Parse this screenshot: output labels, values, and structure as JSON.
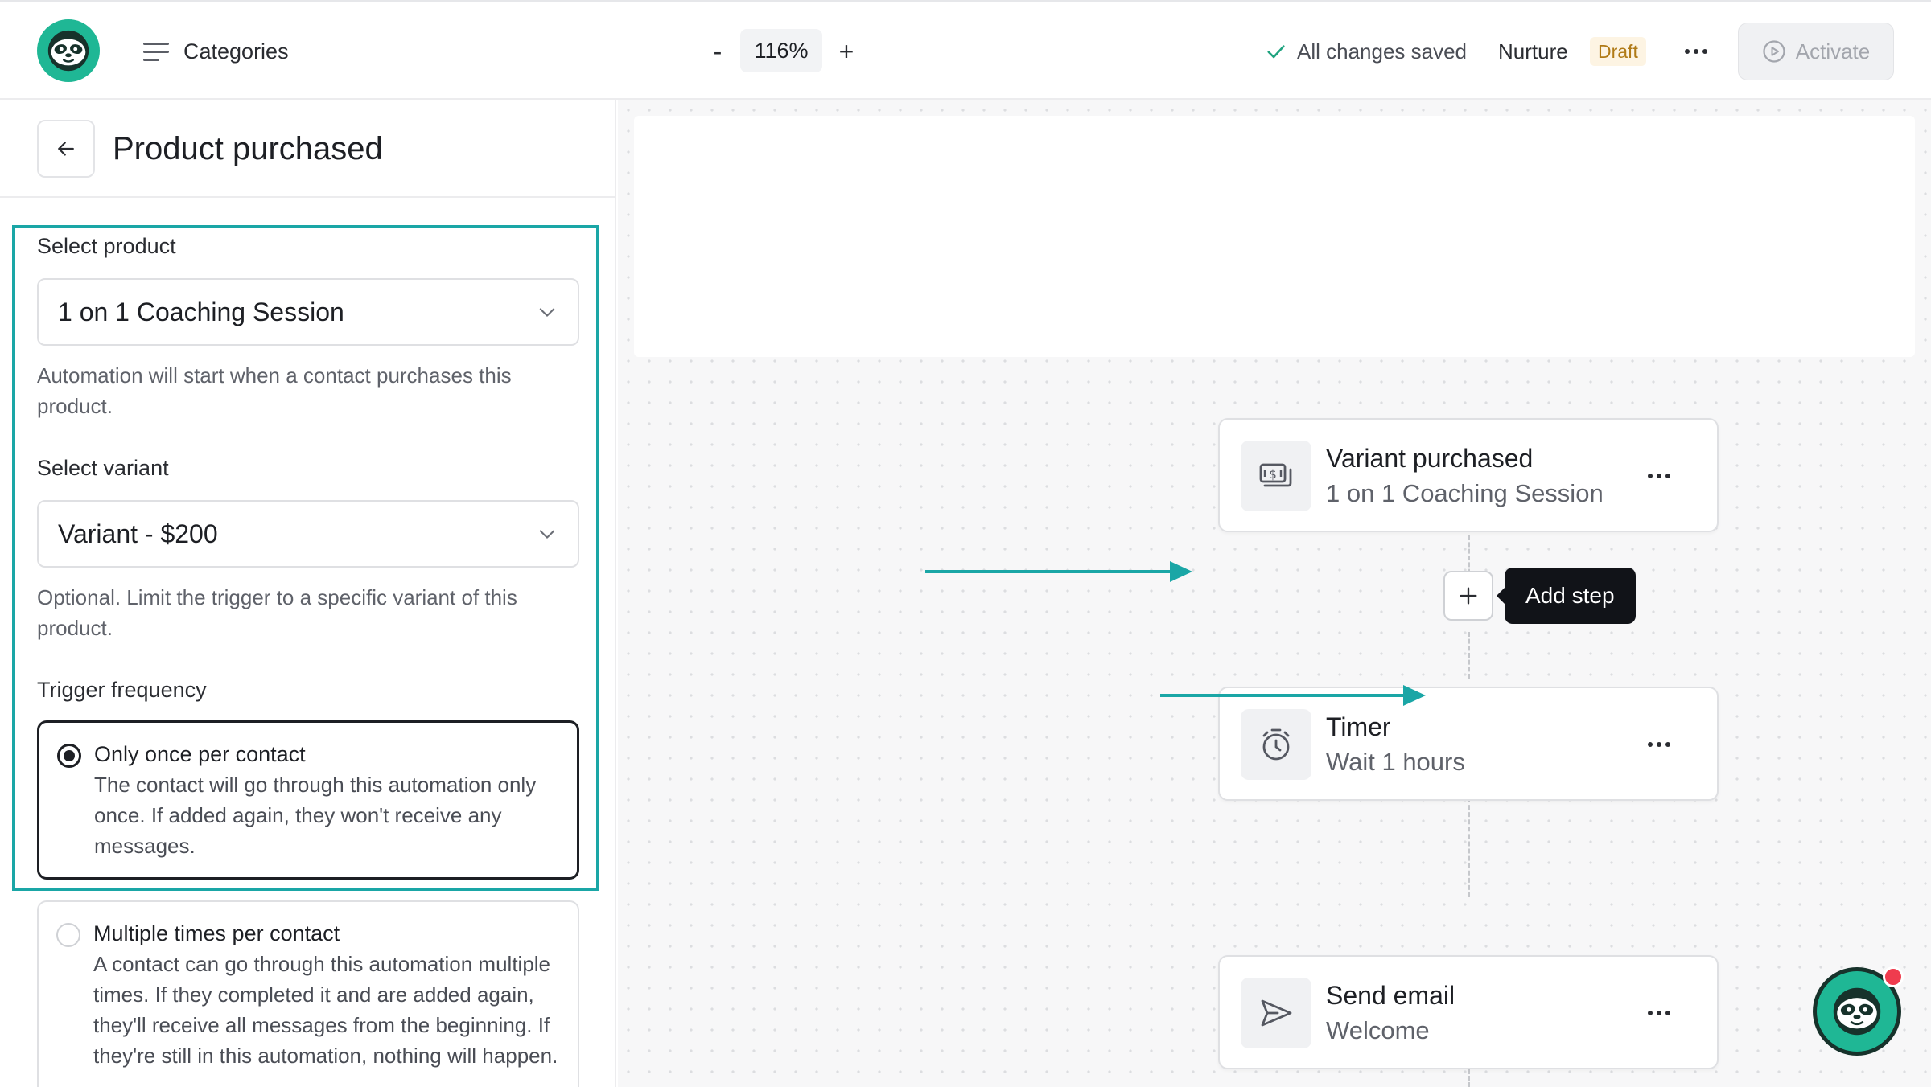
{
  "header": {
    "categories_label": "Categories",
    "zoom_minus": "-",
    "zoom_value": "116%",
    "zoom_plus": "+",
    "save_status": "All changes saved",
    "flow_name": "Nurture",
    "status_badge": "Draft",
    "activate_label": "Activate"
  },
  "panel": {
    "title": "Product purchased",
    "product": {
      "label": "Select product",
      "value": "1 on 1 Coaching Session",
      "help": "Automation will start when a contact purchases this product."
    },
    "variant": {
      "label": "Select variant",
      "value": "Variant - $200",
      "help": "Optional. Limit the trigger to a specific variant of this product."
    },
    "frequency": {
      "label": "Trigger frequency",
      "options": [
        {
          "title": "Only once per contact",
          "description": "The contact will go through this automation only once. If added again, they won't receive any messages.",
          "selected": true
        },
        {
          "title": "Multiple times per contact",
          "description": "A contact can go through this automation multiple times. If they completed it and are added again, they'll receive all messages from the beginning. If they're still in this automation, nothing will happen.",
          "selected": false
        }
      ]
    }
  },
  "canvas": {
    "nodes": [
      {
        "title": "Variant purchased",
        "subtitle": "1 on 1 Coaching Session",
        "icon": "money-icon"
      },
      {
        "title": "Timer",
        "subtitle": "Wait 1 hours",
        "icon": "stopwatch-icon"
      },
      {
        "title": "Send email",
        "subtitle": "Welcome",
        "icon": "send-icon"
      }
    ],
    "add_step_tooltip": "Add step"
  },
  "colors": {
    "brand": "#1fb795",
    "highlight": "#1aa6a6",
    "draft_text": "#b07a16",
    "draft_bg": "#fdf4e3",
    "notification": "#ef3c4e"
  }
}
